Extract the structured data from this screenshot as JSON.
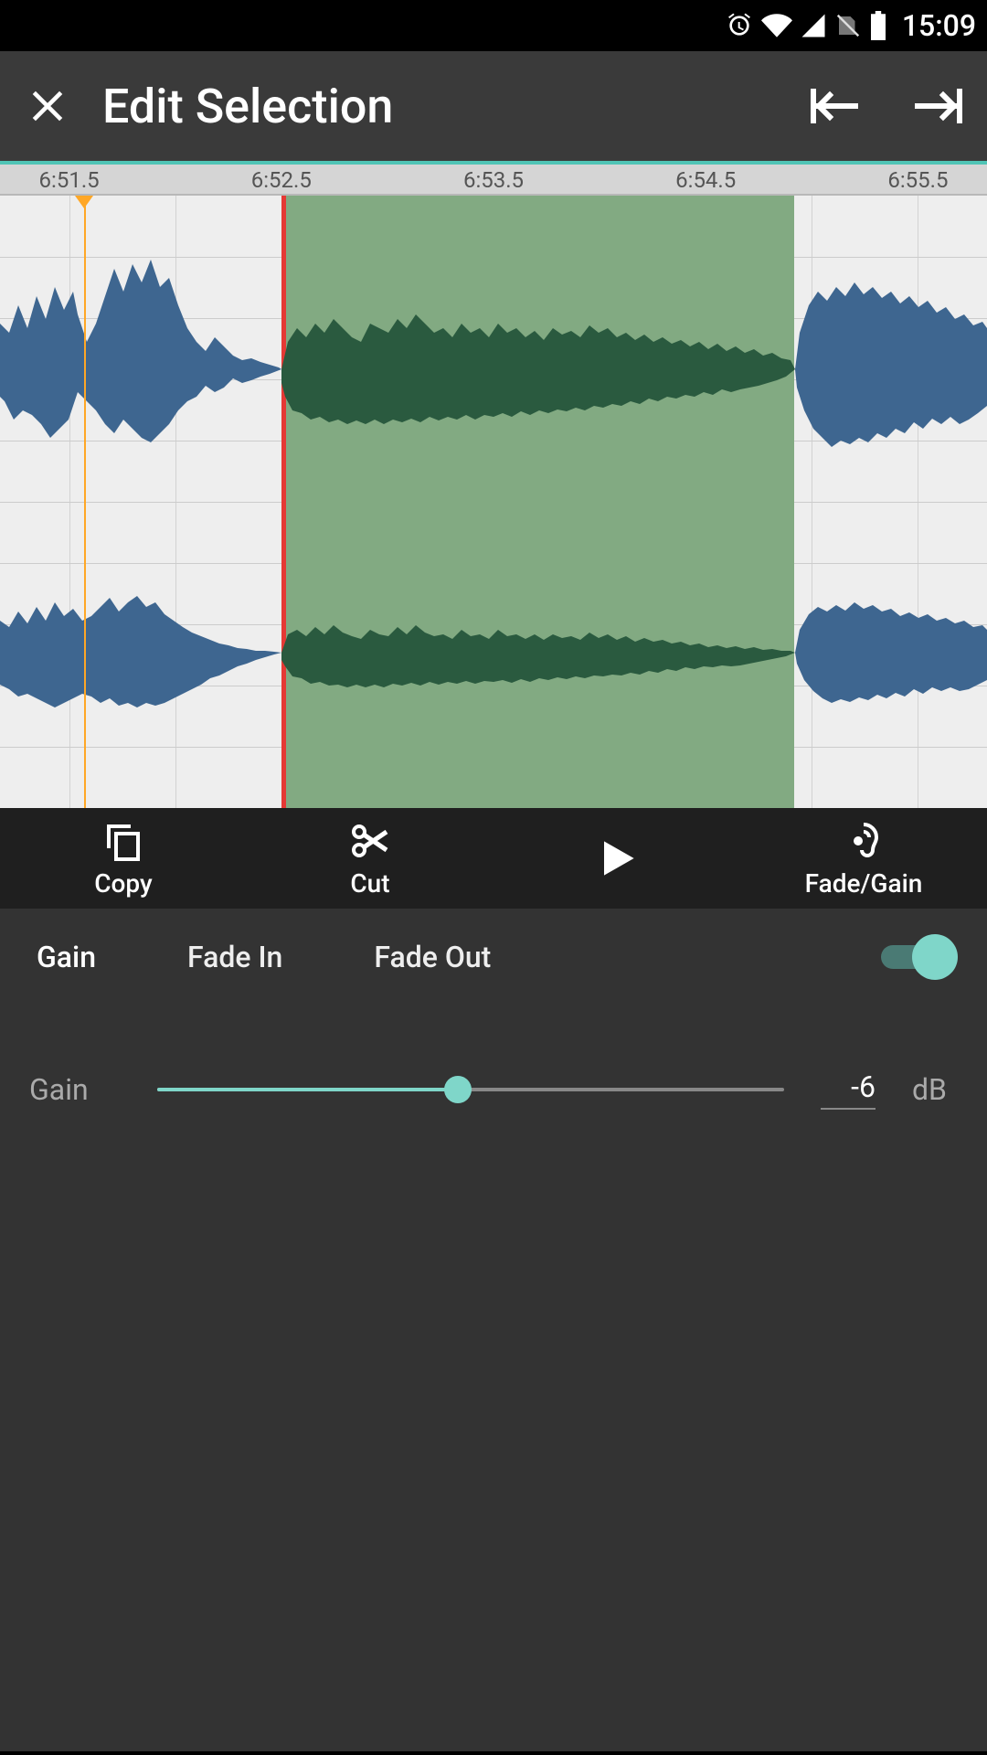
{
  "status": {
    "time": "15:09"
  },
  "header": {
    "title": "Edit Selection"
  },
  "ruler": {
    "ticks": [
      "6:51.5",
      "6:52.5",
      "6:53.5",
      "6:54.5",
      "6:55.5"
    ]
  },
  "waveform": {
    "colors": {
      "wave": "#3e6690",
      "wave_selected": "#2a5a3f",
      "selection_bg": "#82aa82",
      "selection_border": "#e53935",
      "playhead": "#ffa726"
    },
    "selection": {
      "start_pct": 28.5,
      "end_pct": 80.5
    },
    "playhead_pct": 8.5
  },
  "toolbar": {
    "copy": "Copy",
    "cut": "Cut",
    "fadegain": "Fade/Gain"
  },
  "tabs": {
    "gain": "Gain",
    "fadein": "Fade In",
    "fadeout": "Fade Out"
  },
  "gain": {
    "label": "Gain",
    "value": "-6",
    "unit": "dB",
    "slider_pct": 48
  },
  "colors": {
    "accent": "#7fd6c9"
  }
}
